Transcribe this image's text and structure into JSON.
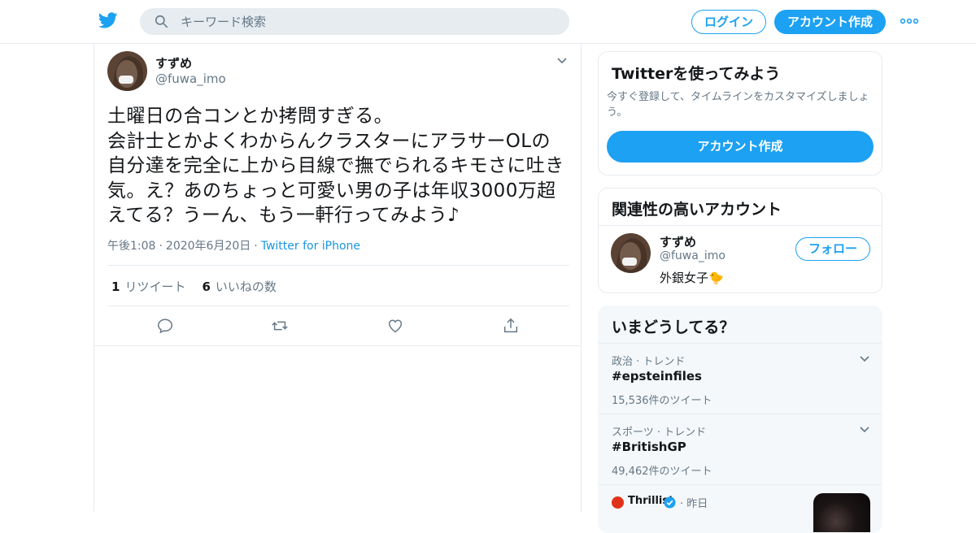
{
  "header": {
    "search_placeholder": "キーワード検索",
    "login_label": "ログイン",
    "signup_label": "アカウント作成",
    "brand_color": "#1da1f2"
  },
  "tweet": {
    "author_name": "すずめ",
    "author_handle": "@fuwa_imo",
    "text": "土曜日の合コンとか拷問すぎる。\n会計士とかよくわからんクラスターにアラサーOLの\n自分達を完全に上から目線で撫でられるキモさに吐き\n気。え？あのちょっと可愛い男の子は年収3000万超\nえてる？うーん、もう一軒行ってみよう♪",
    "time": "午後1:08",
    "date": "2020年6月20日",
    "via": "Twitter for iPhone",
    "retweet_count": "1",
    "retweet_label": "リツイート",
    "like_count": "6",
    "like_label": "いいねの数"
  },
  "signup_card": {
    "title": "Twitterを使ってみよう",
    "description": "今すぐ登録して、タイムラインをカスタマイズしましょう。",
    "button_label": "アカウント作成"
  },
  "related_card": {
    "title": "関連性の高いアカウント",
    "name": "すずめ",
    "handle": "@fuwa_imo",
    "bio": "外銀女子🐤",
    "follow_label": "フォロー"
  },
  "trends_card": {
    "title": "いまどうしてる？",
    "trends": [
      {
        "context": "政治 · トレンド",
        "name": "#epsteinfiles",
        "count": "15,536件のツイート"
      },
      {
        "context": "スポーツ · トレンド",
        "name": "#BritishGP",
        "count": "49,462件のツイート"
      }
    ],
    "news": {
      "source": "Thrillist",
      "time": "· 昨日"
    }
  }
}
